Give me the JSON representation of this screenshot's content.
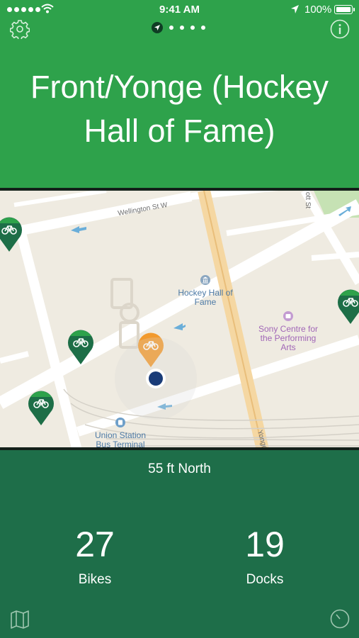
{
  "status_bar": {
    "time": "9:41 AM",
    "battery": "100%"
  },
  "header": {
    "station_name": "Front/Yonge (Hockey Hall of Fame)",
    "page_dots": 4
  },
  "map": {
    "streets": {
      "wellington": "Wellington St W",
      "yonge": "Yonge",
      "top_right": "ott St"
    },
    "pois": {
      "hockey_hall": "Hockey Hall of Fame",
      "sony_centre": "Sony Centre for the Performing Arts",
      "union_station": "Union Station Bus Terminal"
    }
  },
  "station_info": {
    "direction": "55 ft North",
    "bikes_count": "27",
    "bikes_label": "Bikes",
    "docks_count": "19",
    "docks_label": "Docks"
  },
  "colors": {
    "header_green": "#2ea24b",
    "footer_green": "#1e6e49",
    "pin_green": "#1d6e47",
    "pin_orange": "#f29a2e",
    "user_dot": "#1a3c78"
  }
}
